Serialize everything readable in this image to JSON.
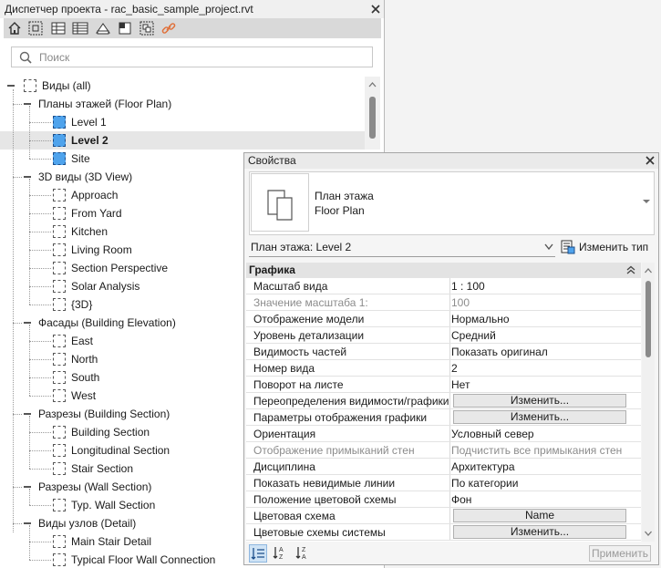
{
  "browser": {
    "title": "Диспетчер проекта - rac_basic_sample_project.rvt",
    "search_placeholder": "Поиск",
    "root": "Виды (all)",
    "groups": [
      {
        "label": "Планы этажей (Floor Plan)",
        "icon": "floor-plan-view-icon",
        "items": [
          "Level 1",
          "Level 2",
          "Site"
        ]
      },
      {
        "label": "3D виды (3D View)",
        "icon": "3d-view-icon",
        "items": [
          "Approach",
          "From Yard",
          "Kitchen",
          "Living Room",
          "Section Perspective",
          "Solar Analysis",
          "{3D}"
        ]
      },
      {
        "label": "Фасады (Building Elevation)",
        "icon": "elevation-view-icon",
        "items": [
          "East",
          "North",
          "South",
          "West"
        ]
      },
      {
        "label": "Разрезы (Building Section)",
        "icon": "section-view-icon",
        "items": [
          "Building Section",
          "Longitudinal Section",
          "Stair Section"
        ]
      },
      {
        "label": "Разрезы (Wall Section)",
        "icon": "section-view-icon",
        "items": [
          "Typ. Wall Section"
        ]
      },
      {
        "label": "Виды узлов (Detail)",
        "icon": "detail-view-icon",
        "items": [
          "Main Stair Detail",
          "Typical Floor Wall Connection"
        ]
      }
    ],
    "selected_item": "Level 2"
  },
  "properties": {
    "title": "Свойства",
    "type_name_line1": "План этажа",
    "type_name_line2": "Floor Plan",
    "instance_selector": "План этажа: Level 2",
    "edit_type_label": "Изменить тип",
    "group_title": "Графика",
    "rows": [
      {
        "name": "Масштаб вида",
        "value": "1 : 100"
      },
      {
        "name": "Значение масштаба    1:",
        "value": "100",
        "disabled": true
      },
      {
        "name": "Отображение модели",
        "value": "Нормально"
      },
      {
        "name": "Уровень детализации",
        "value": "Средний"
      },
      {
        "name": "Видимость частей",
        "value": "Показать оригинал"
      },
      {
        "name": "Номер вида",
        "value": "2"
      },
      {
        "name": "Поворот на листе",
        "value": "Нет"
      },
      {
        "name": "Переопределения видимости/графики",
        "button": "Изменить..."
      },
      {
        "name": "Параметры отображения графики",
        "button": "Изменить..."
      },
      {
        "name": "Ориентация",
        "value": "Условный север"
      },
      {
        "name": "Отображение примыканий стен",
        "value": "Подчистить все примыкания стен",
        "disabled": true
      },
      {
        "name": "Дисциплина",
        "value": "Архитектура"
      },
      {
        "name": "Показать невидимые линии",
        "value": "По категории"
      },
      {
        "name": "Положение цветовой схемы",
        "value": "Фон"
      },
      {
        "name": "Цветовая схема",
        "button": "Name"
      },
      {
        "name": "Цветовые схемы системы",
        "button": "Изменить..."
      }
    ],
    "apply_label": "Применить",
    "sort_modes": [
      "categorized-sort-icon",
      "sort-ascending-icon",
      "sort-descending-icon"
    ]
  }
}
